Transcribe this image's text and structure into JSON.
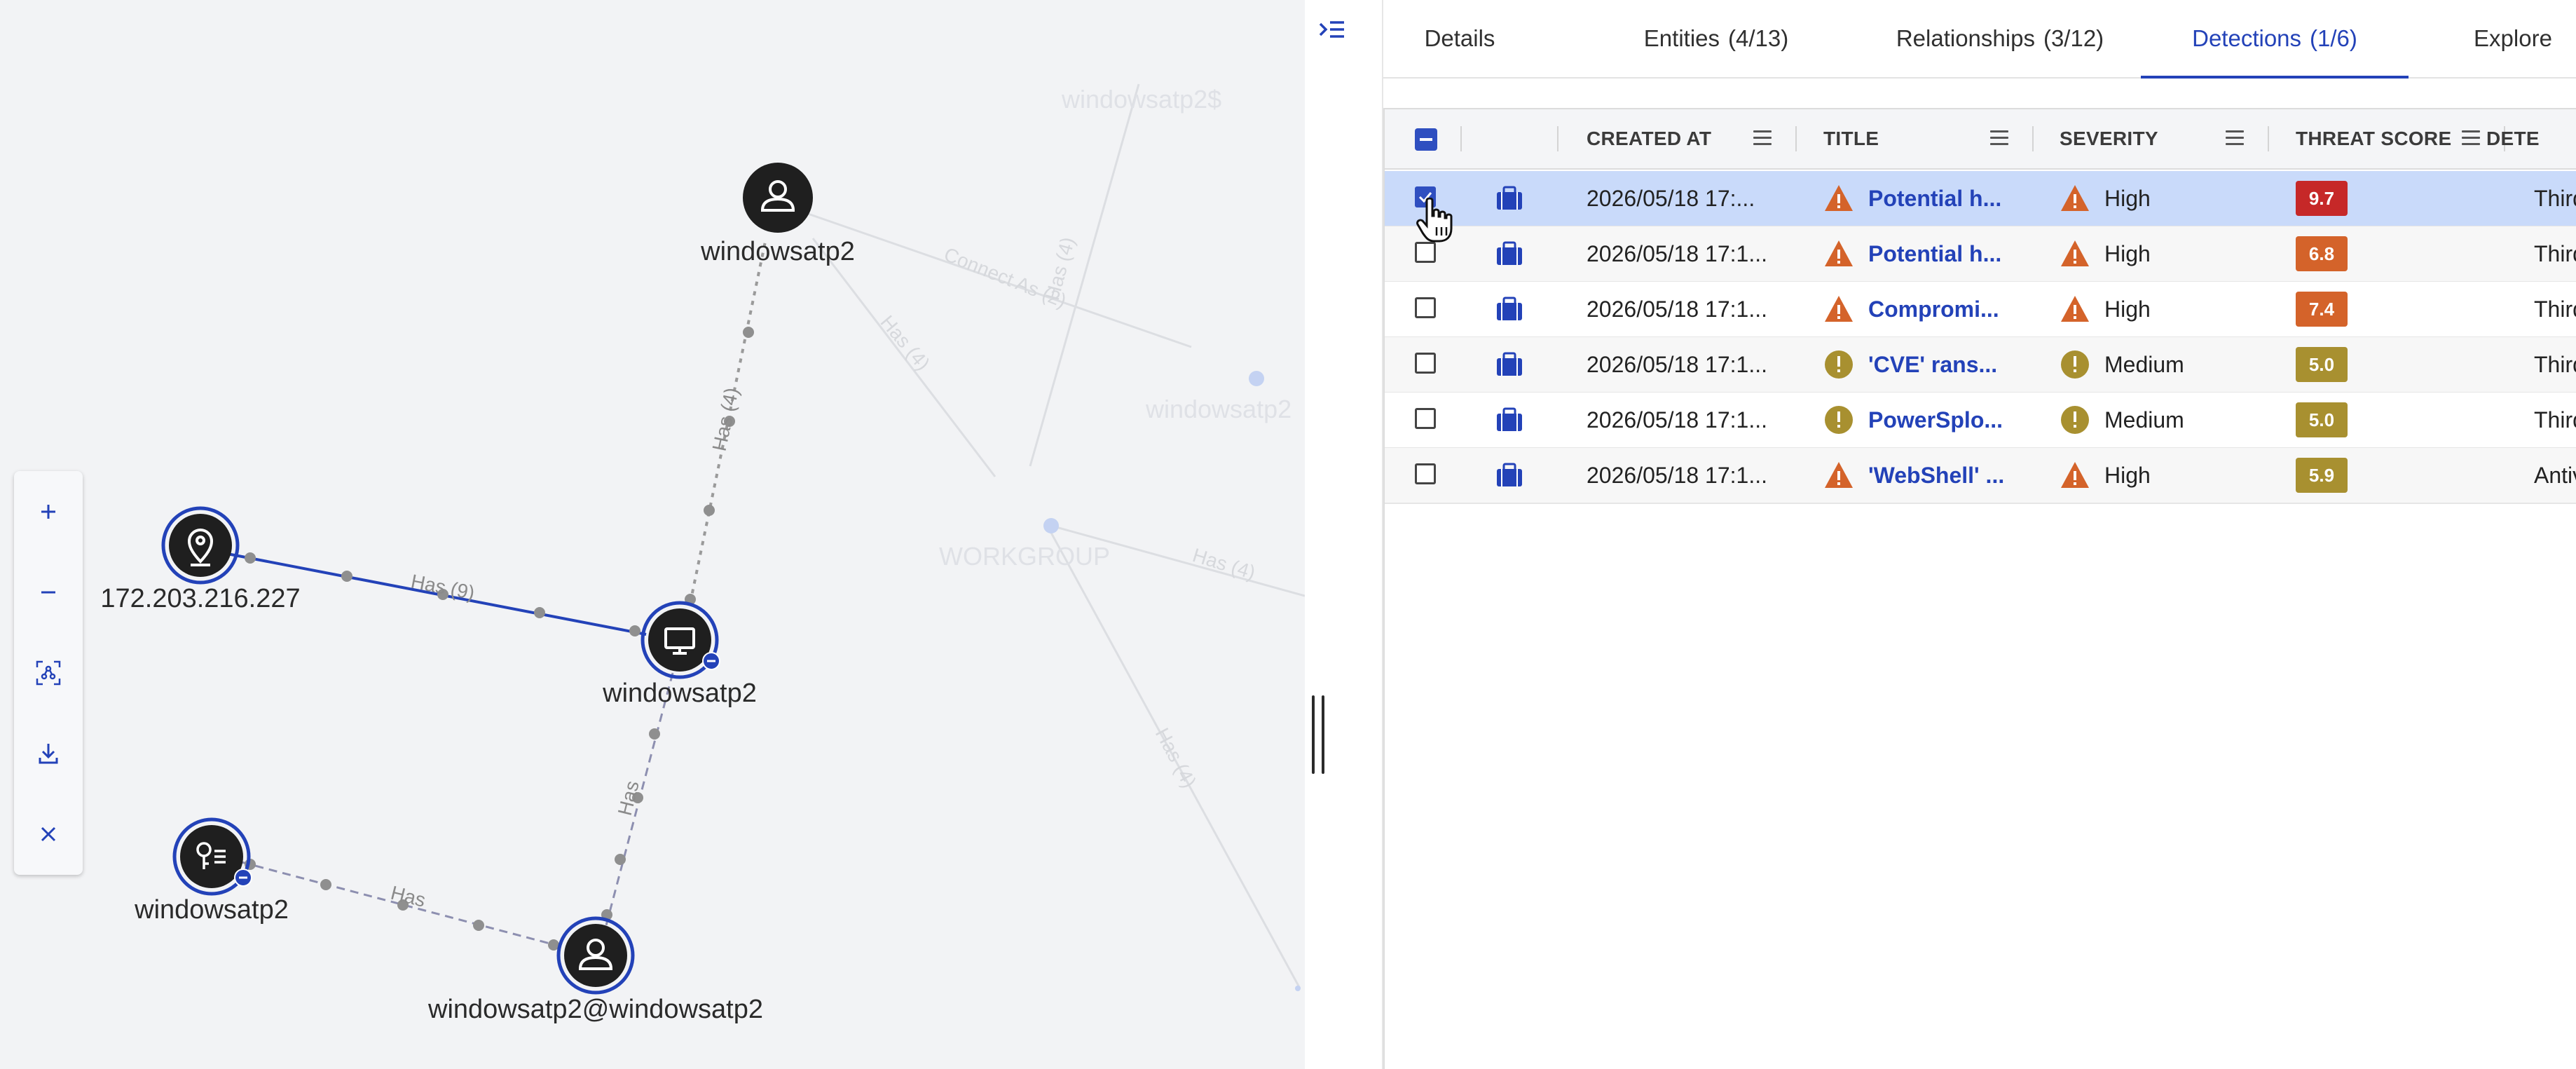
{
  "graph": {
    "nodes": [
      {
        "id": "user-top",
        "label": "windowsatp2",
        "icon": "user-icon"
      },
      {
        "id": "ip",
        "label": "172.203.216.227",
        "icon": "location-pin-icon"
      },
      {
        "id": "host",
        "label": "windowsatp2",
        "icon": "monitor-icon"
      },
      {
        "id": "key",
        "label": "windowsatp2",
        "icon": "key-icon"
      },
      {
        "id": "account",
        "label": "windowsatp2@windowsatp2",
        "icon": "user-icon"
      }
    ],
    "edges": [
      {
        "from": "ip",
        "to": "host",
        "label": "Has (9)"
      },
      {
        "from": "host",
        "to": "user-top",
        "label": "Has (4)"
      },
      {
        "from": "host",
        "to": "account",
        "label": "Has"
      },
      {
        "from": "key",
        "to": "account",
        "label": "Has"
      }
    ],
    "faded_labels": [
      "windowsatp2$",
      "windowsatp2",
      "WORKGROUP"
    ],
    "faded_edge_labels": [
      "Connect As (2)",
      "Has (4)",
      "Has (4)",
      "Has (4)",
      "Has (4)"
    ],
    "colors": {
      "selection_ring": "#2342b8",
      "node_fill": "#1f1f1f",
      "edge_selected": "#2342b8",
      "edge": "#9a9a9a"
    }
  },
  "toolbar": {
    "buttons": [
      "zoom-in-icon",
      "zoom-out-icon",
      "fit-view-icon",
      "download-icon",
      "close-icon"
    ]
  },
  "tabs": [
    {
      "label": "Details",
      "count": ""
    },
    {
      "label": "Entities",
      "count": "(4/13)"
    },
    {
      "label": "Relationships",
      "count": "(3/12)"
    },
    {
      "label": "Detections",
      "count": "(1/6)",
      "active": true
    },
    {
      "label": "Explore",
      "count": ""
    }
  ],
  "table": {
    "columns": {
      "created_at": "CREATED AT",
      "title": "TITLE",
      "severity": "SEVERITY",
      "threat_score": "THREAT SCORE",
      "detection": "DETE"
    },
    "rows": [
      {
        "created_at": "2026/05/18 17:...",
        "title": "Potential h...",
        "severity": "High",
        "severity_level": "high",
        "score": "9.7",
        "score_color": "#c62828",
        "detection": "Third",
        "checked": true
      },
      {
        "created_at": "2026/05/18 17:1...",
        "title": "Potential h...",
        "severity": "High",
        "severity_level": "high",
        "score": "6.8",
        "score_color": "#d4632a",
        "detection": "Third",
        "checked": false
      },
      {
        "created_at": "2026/05/18 17:1...",
        "title": "Compromi...",
        "severity": "High",
        "severity_level": "high",
        "score": "7.4",
        "score_color": "#d4632a",
        "detection": "Third",
        "checked": false
      },
      {
        "created_at": "2026/05/18 17:1...",
        "title": "'CVE' rans...",
        "severity": "Medium",
        "severity_level": "medium",
        "score": "5.0",
        "score_color": "#a89030",
        "detection": "Third",
        "checked": false
      },
      {
        "created_at": "2026/05/18 17:1...",
        "title": "PowerSplo...",
        "severity": "Medium",
        "severity_level": "medium",
        "score": "5.0",
        "score_color": "#a89030",
        "detection": "Third",
        "checked": false
      },
      {
        "created_at": "2026/05/18 17:1...",
        "title": "'WebShell' ...",
        "severity": "High",
        "severity_level": "high",
        "score": "5.9",
        "score_color": "#a89030",
        "detection": "Antiv",
        "checked": false
      }
    ],
    "colors": {
      "high": "#d4632a",
      "medium": "#a89030",
      "selected_row": "#c9dafa",
      "link": "#2342b8",
      "case_icon": "#2342b8"
    }
  }
}
